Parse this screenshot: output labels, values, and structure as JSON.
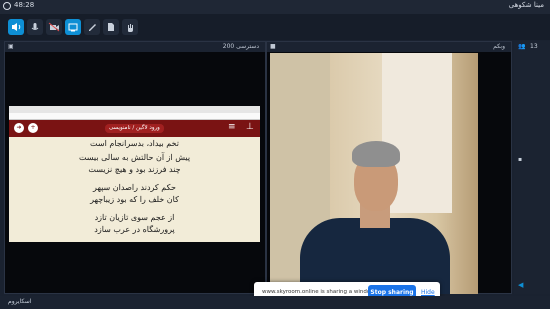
{
  "titlebar": {
    "time": "48:28",
    "user": "مینا شکوهی"
  },
  "panels": {
    "left_title": "200 دسترسی",
    "right_title": "وبکم",
    "users_count": "13"
  },
  "shared": {
    "app_title": "ورود لاگین / نامنویسی",
    "lines": [
      "تخم بیداد، بدسرانجام است",
      "پیش از آن حالتش به سالی بیست",
      "چند فرزند بود و هیچ نزیست",
      "حکم کردند راصدان سپهر",
      "کان خلف را که بود زیباچهر",
      "از عجم سوی تازیان تازد",
      "پرورشگاه در عرب سازد"
    ]
  },
  "notice": {
    "text": "www.skyroom.online is sharing a window.",
    "stop_label": "Stop sharing",
    "hide_label": "Hide"
  },
  "footer": {
    "brand": "اسکایروم"
  },
  "colors": {
    "accent": "#0e8fd4",
    "app_bar": "#7a1313",
    "stop_button": "#1a73e8"
  }
}
